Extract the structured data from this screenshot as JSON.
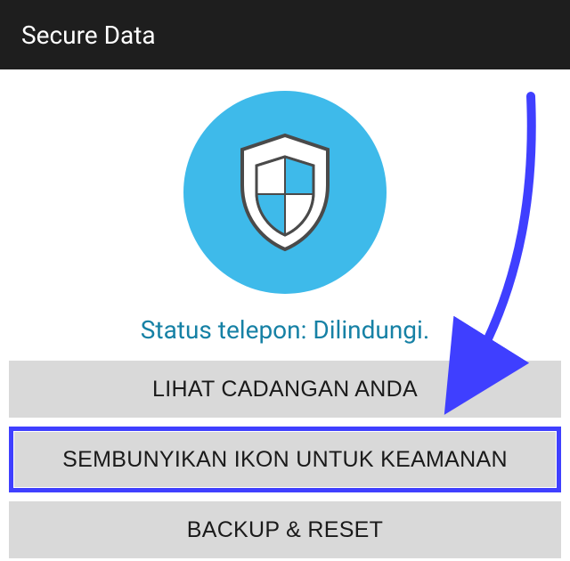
{
  "header": {
    "title": "Secure Data"
  },
  "status": {
    "text": "Status telepon: Dilindungi."
  },
  "buttons": {
    "view_backup": "LIHAT CADANGAN ANDA",
    "hide_icon": "SEMBUNYIKAN IKON UNTUK KEAMANAN",
    "backup_reset": "BACKUP & RESET"
  },
  "icons": {
    "shield": "shield-icon"
  },
  "colors": {
    "accent_circle": "#3ebaea",
    "status_text": "#1681a5",
    "highlight_frame": "#3f3fff",
    "button_bg": "#d9d9d9"
  }
}
